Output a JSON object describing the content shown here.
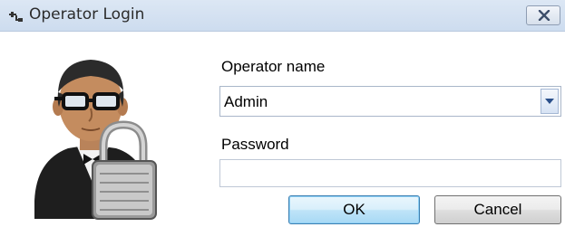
{
  "window": {
    "title": "Operator Login"
  },
  "form": {
    "operator_label": "Operator name",
    "operator_value": "Admin",
    "password_label": "Password",
    "password_value": ""
  },
  "buttons": {
    "ok_label": "OK",
    "cancel_label": "Cancel"
  },
  "icons": {
    "title": "network-plug-icon",
    "close": "close-icon",
    "avatar": "operator-with-padlock-icon",
    "dropdown": "chevron-down-icon"
  },
  "colors": {
    "titlebar": "#cddcef",
    "ok_border": "#3c7fb1",
    "dropdown_arrow": "#2a4f8a"
  }
}
